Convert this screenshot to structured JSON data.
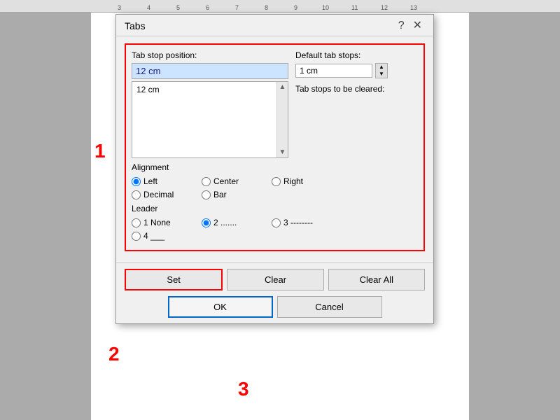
{
  "ruler": {
    "ticks": [
      "3",
      "4",
      "5",
      "6",
      "7",
      "8",
      "9",
      "10",
      "11",
      "12",
      "13"
    ]
  },
  "dialog": {
    "title": "Tabs",
    "help_button": "?",
    "close_button": "✕",
    "tab_stop_position_label": "Tab stop position:",
    "tab_stop_value": "12 cm",
    "tab_stop_list_items": [
      "12 cm"
    ],
    "default_tab_stops_label": "Default tab stops:",
    "default_tab_value": "1 cm",
    "tab_stops_to_clear_label": "Tab stops to be cleared:",
    "alignment_label": "Alignment",
    "alignment_options": [
      {
        "id": "left",
        "label": "Left",
        "checked": true
      },
      {
        "id": "center",
        "label": "Center",
        "checked": false
      },
      {
        "id": "right",
        "label": "Right",
        "checked": false
      },
      {
        "id": "decimal",
        "label": "Decimal",
        "checked": false
      },
      {
        "id": "bar",
        "label": "Bar",
        "checked": false
      }
    ],
    "leader_label": "Leader",
    "leader_options": [
      {
        "id": "none",
        "label": "1 None",
        "checked": false
      },
      {
        "id": "dots",
        "label": "2 .......",
        "checked": true
      },
      {
        "id": "dashes",
        "label": "3 --------",
        "checked": false
      },
      {
        "id": "underline",
        "label": "4 ___",
        "checked": false
      }
    ],
    "set_button": "Set",
    "clear_button": "Clear",
    "clear_all_button": "Clear All",
    "ok_button": "OK",
    "cancel_button": "Cancel"
  },
  "labels": {
    "one": "1",
    "two": "2",
    "three": "3"
  }
}
